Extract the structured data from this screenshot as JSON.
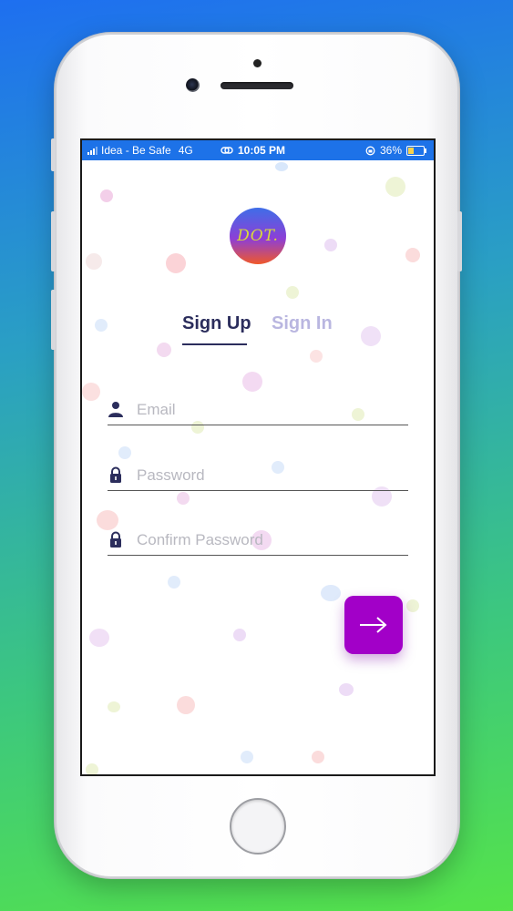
{
  "status_bar": {
    "carrier": "Idea - Be Safe",
    "network": "4G",
    "time": "10:05 PM",
    "battery_percent": "36%",
    "background_color": "#1d72e8"
  },
  "logo": {
    "text": "DOT."
  },
  "tabs": [
    {
      "label": "Sign Up",
      "active": true
    },
    {
      "label": "Sign In",
      "active": false
    }
  ],
  "form": {
    "email": {
      "placeholder": "Email",
      "value": "",
      "icon": "user-icon"
    },
    "password": {
      "placeholder": "Password",
      "value": "",
      "icon": "lock-icon"
    },
    "confirm_password": {
      "placeholder": "Confirm Password",
      "value": "",
      "icon": "lock-icon"
    }
  },
  "submit_button": {
    "icon": "arrow-right-icon",
    "color": "#a200c8"
  },
  "colors": {
    "primary_text": "#2b2d5c",
    "inactive_tab": "#b9b6e0",
    "accent": "#a200c8"
  }
}
